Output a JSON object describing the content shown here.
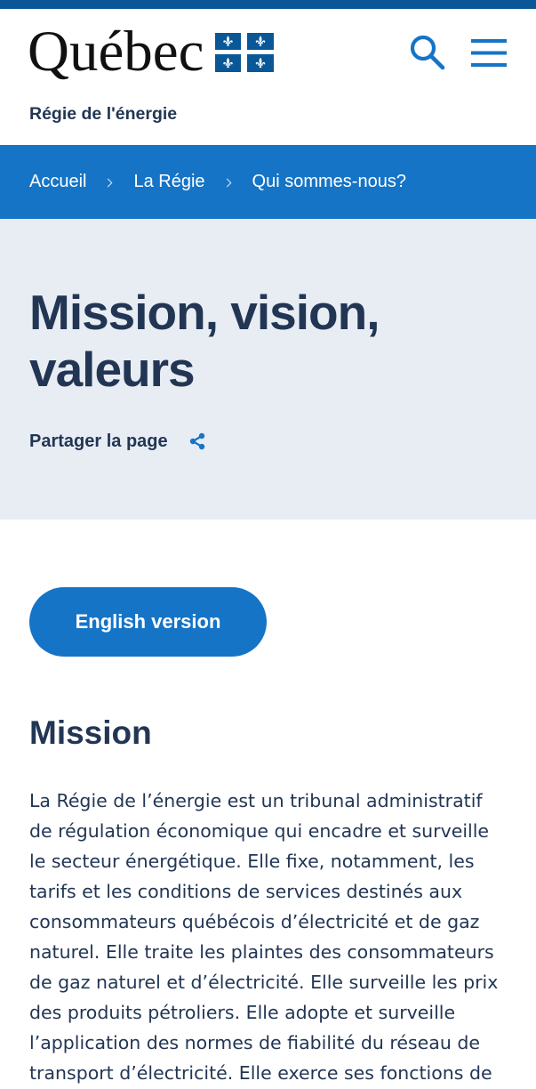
{
  "colors": {
    "top_strip": "#095797",
    "flag_blue": "#095797",
    "primary": "#1574c6",
    "navy": "#223654",
    "hero_bg": "#e8edf4"
  },
  "header": {
    "logo_text": "Québec",
    "logo_flag_icon": "quebec-flag-icon",
    "site_name": "Régie de l'énergie",
    "search_icon": "search-icon",
    "menu_icon": "hamburger-menu-icon"
  },
  "breadcrumb": {
    "separator_icon": "chevron-right-icon",
    "items": [
      {
        "label": "Accueil"
      },
      {
        "label": "La Régie"
      },
      {
        "label": "Qui sommes-nous?"
      }
    ]
  },
  "hero": {
    "title": "Mission, vision, valeurs",
    "share_label": "Partager la page",
    "share_icon": "share-icon"
  },
  "main": {
    "language_button": "English version",
    "section_heading": "Mission",
    "paragraph_lines": [
      "La Régie de l’énergie est un tribunal administratif",
      "de régulation économique qui encadre et surveille",
      "le secteur énergétique. Elle fixe, notamment, les",
      "tarifs et les conditions de services destinés aux",
      "consommateurs québécois d’électricité et de gaz",
      "naturel. Elle traite les plaintes des consommateurs",
      "de gaz naturel et d’électricité. Elle surveille les prix",
      "des produits pétroliers. Elle adopte et surveille",
      "l’application des normes de fiabilité du réseau de",
      "transport d’électricité. Elle exerce ses fonctions de"
    ]
  }
}
